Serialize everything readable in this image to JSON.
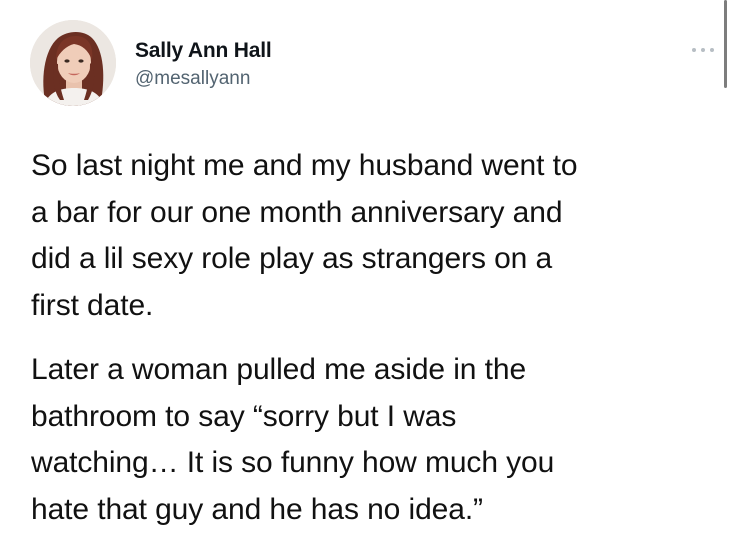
{
  "tweet": {
    "author": {
      "display_name": "Sally Ann Hall",
      "handle": "@mesallyann",
      "avatar_icon": "profile-photo"
    },
    "more_icon": "ellipsis-icon",
    "paragraphs": [
      {
        "lines": [
          "So last night me and my husband went to",
          "a bar for our one month anniversary and",
          "did a lil sexy role play as strangers on a",
          "first date."
        ]
      },
      {
        "lines": [
          "Later a woman pulled me aside in the",
          "bathroom to say “sorry but I was",
          "watching… It is so funny how much you",
          "hate that guy and he has no idea.”"
        ]
      }
    ]
  },
  "colors": {
    "text": "#111111",
    "handle": "#536471",
    "background": "#ffffff"
  }
}
